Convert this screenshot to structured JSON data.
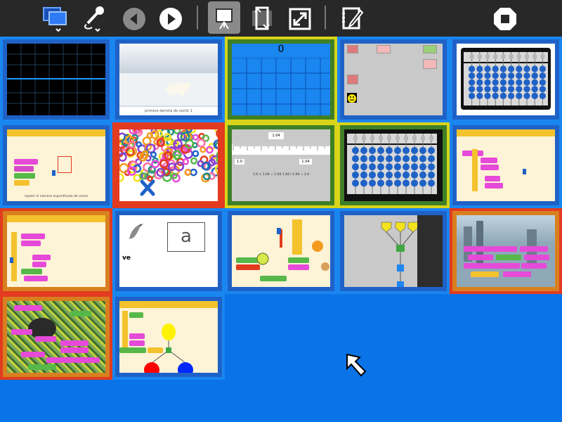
{
  "toolbar": {
    "buttons": [
      {
        "name": "view-icon",
        "active": false
      },
      {
        "name": "microphone-icon",
        "active": false
      },
      {
        "name": "back-icon",
        "active": false
      },
      {
        "name": "play-icon",
        "active": false
      },
      {
        "name": "presentation-icon",
        "active": true
      },
      {
        "name": "rotate-icon",
        "active": false
      },
      {
        "name": "fullscreen-icon",
        "active": false
      },
      {
        "name": "notes-icon",
        "active": false
      },
      {
        "name": "stop-icon",
        "active": false
      }
    ]
  },
  "thumbnails": [
    {
      "id": "t1",
      "label": ""
    },
    {
      "id": "t2",
      "label": "primero derrota de soclin 1"
    },
    {
      "id": "t3",
      "label": "0"
    },
    {
      "id": "t4",
      "label": ""
    },
    {
      "id": "t5",
      "label": ""
    },
    {
      "id": "t6",
      "label": "repetir el número especificado de veces"
    },
    {
      "id": "t7",
      "label": ""
    },
    {
      "id": "t8",
      "label": "1.04"
    },
    {
      "id": "t9",
      "label": ""
    },
    {
      "id": "t10",
      "label": ""
    },
    {
      "id": "t11",
      "label": ""
    },
    {
      "id": "t12",
      "label": "a"
    },
    {
      "id": "t13",
      "label": ""
    },
    {
      "id": "t14",
      "label": ""
    },
    {
      "id": "t15",
      "label": ""
    },
    {
      "id": "t16",
      "label": ""
    },
    {
      "id": "t17",
      "label": ""
    }
  ],
  "thumb12": {
    "letter": "a",
    "caption": "ve"
  },
  "thumb8": {
    "top": "1.04",
    "mid_left": "1.0",
    "mid_right": "1.04",
    "bottom": "1.0 × 1.04 = 1.04     1.04 / 1.04 = 1.0"
  },
  "colors": {
    "accent": "#0a73e8",
    "toolbar": "#282828"
  }
}
